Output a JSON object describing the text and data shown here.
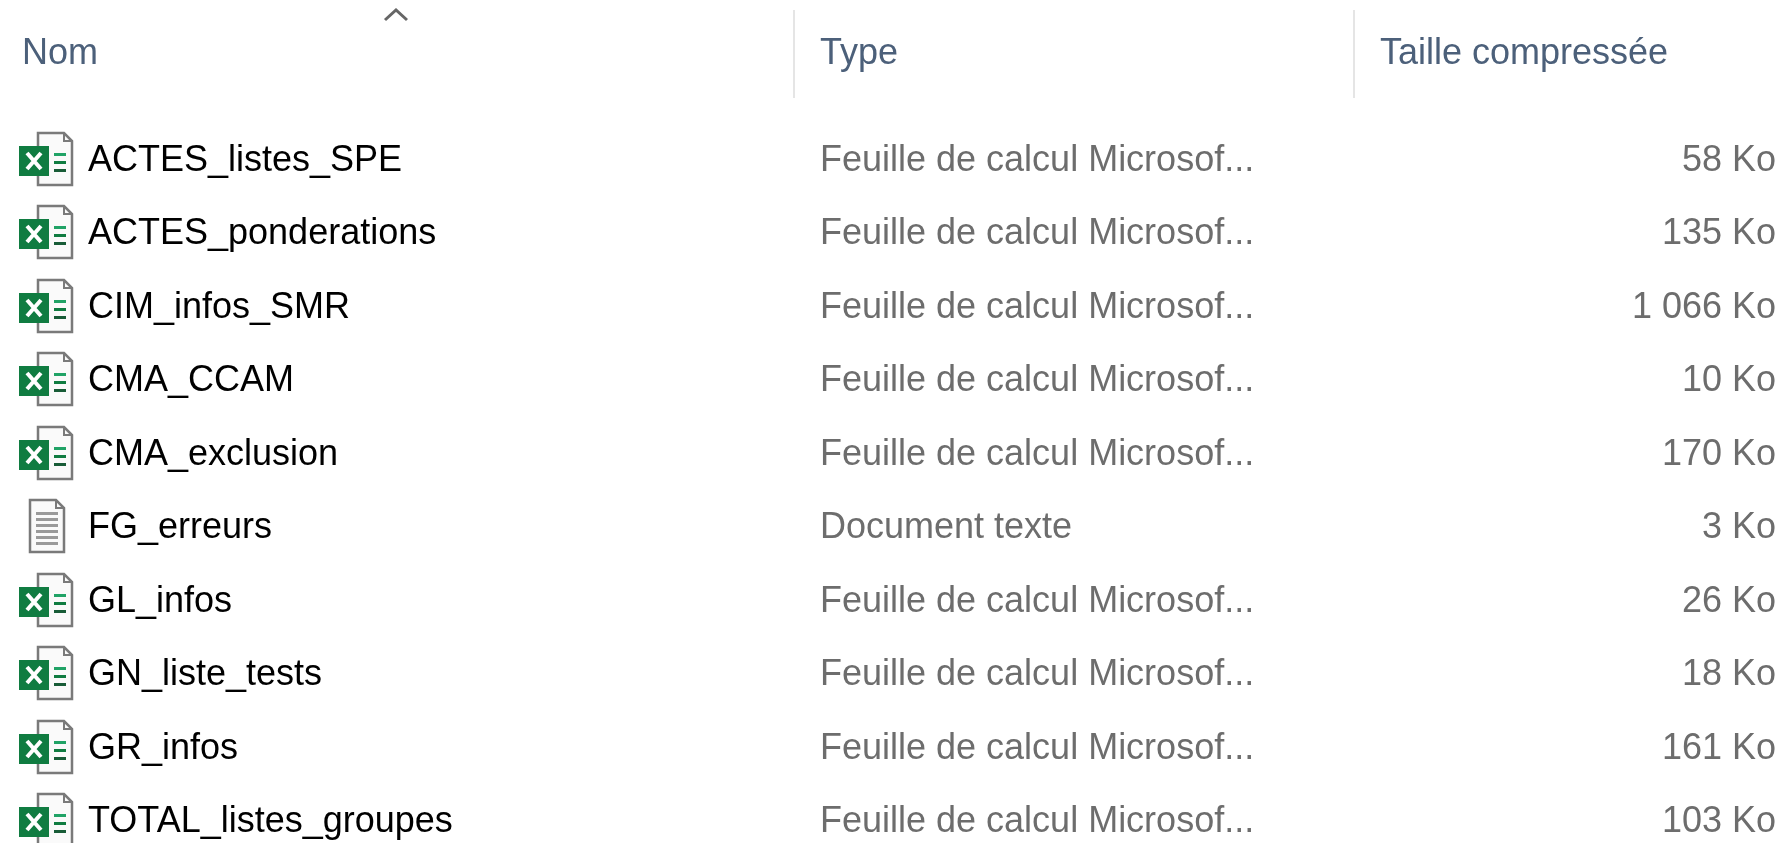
{
  "columns": [
    {
      "label": "Nom",
      "sorted": true
    },
    {
      "label": "Type",
      "sorted": false
    },
    {
      "label": "Taille compressée",
      "sorted": false
    }
  ],
  "files": [
    {
      "kind": "spreadsheet",
      "name": "ACTES_listes_SPE",
      "type": "Feuille de calcul Microsof...",
      "size": "58 Ko"
    },
    {
      "kind": "spreadsheet",
      "name": "ACTES_ponderations",
      "type": "Feuille de calcul Microsof...",
      "size": "135 Ko"
    },
    {
      "kind": "spreadsheet",
      "name": "CIM_infos_SMR",
      "type": "Feuille de calcul Microsof...",
      "size": "1 066 Ko"
    },
    {
      "kind": "spreadsheet",
      "name": "CMA_CCAM",
      "type": "Feuille de calcul Microsof...",
      "size": "10 Ko"
    },
    {
      "kind": "spreadsheet",
      "name": "CMA_exclusion",
      "type": "Feuille de calcul Microsof...",
      "size": "170 Ko"
    },
    {
      "kind": "text",
      "name": "FG_erreurs",
      "type": "Document texte",
      "size": "3 Ko"
    },
    {
      "kind": "spreadsheet",
      "name": "GL_infos",
      "type": "Feuille de calcul Microsof...",
      "size": "26 Ko"
    },
    {
      "kind": "spreadsheet",
      "name": "GN_liste_tests",
      "type": "Feuille de calcul Microsof...",
      "size": "18 Ko"
    },
    {
      "kind": "spreadsheet",
      "name": "GR_infos",
      "type": "Feuille de calcul Microsof...",
      "size": "161 Ko"
    },
    {
      "kind": "spreadsheet",
      "name": "TOTAL_listes_groupes",
      "type": "Feuille de calcul Microsof...",
      "size": "103 Ko"
    }
  ]
}
